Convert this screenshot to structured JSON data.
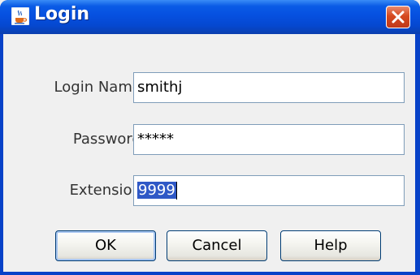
{
  "window": {
    "title": "Login",
    "title_icon": "java-coffee-cup-icon",
    "close_icon": "close-icon"
  },
  "form": {
    "login_name": {
      "label": "Login Name:",
      "value": "smithj"
    },
    "password": {
      "label": "Password:",
      "value": "*****"
    },
    "extension": {
      "label": "Extension:",
      "value": "9999"
    }
  },
  "buttons": {
    "ok": "OK",
    "cancel": "Cancel",
    "help": "Help"
  },
  "colors": {
    "titlebar": "#0a5be6",
    "close_button": "#d6491f",
    "selection": "#2f58c6",
    "dialog_bg": "#f0f0f0"
  }
}
